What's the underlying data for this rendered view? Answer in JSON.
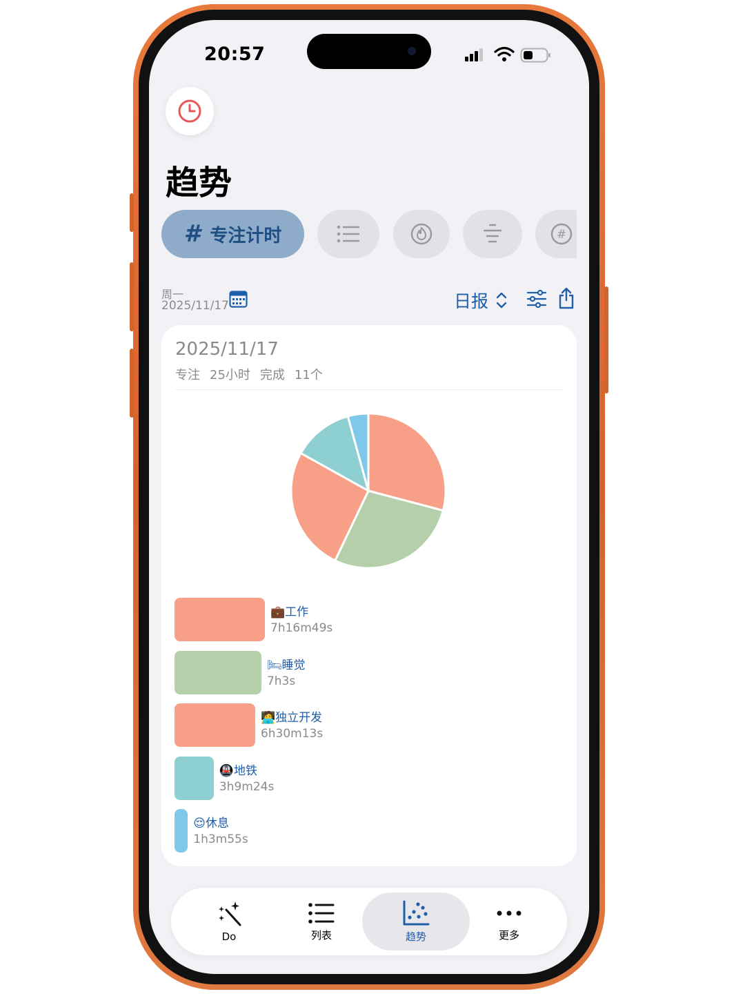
{
  "status_bar": {
    "time": "20:57"
  },
  "page": {
    "title": "趋势"
  },
  "filter_tabs": {
    "active_label": "专注计时",
    "active_icon": "#"
  },
  "date_header": {
    "weekday": "周一",
    "date": "2025/11/17",
    "report_label": "日报"
  },
  "card": {
    "date": "2025/11/17",
    "focus_label": "专注",
    "focus_value": "25小时",
    "done_label": "完成",
    "done_value": "11个"
  },
  "chart_data": {
    "type": "pie",
    "slices": [
      {
        "label": "工作",
        "emoji": "💼",
        "duration": "7h16m49s",
        "hours": 7.28,
        "color": "#f79f87"
      },
      {
        "label": "睡觉",
        "emoji": "🛏",
        "duration": "7h3s",
        "hours": 7.0,
        "color": "#b4cfa9"
      },
      {
        "label": "独立开发",
        "emoji": "🧑‍💻",
        "duration": "6h30m13s",
        "hours": 6.5,
        "color": "#f79f87"
      },
      {
        "label": "地铁",
        "emoji": "🚇",
        "duration": "3h9m24s",
        "hours": 3.16,
        "color": "#8ed0d2"
      },
      {
        "label": "休息",
        "emoji": "😌",
        "duration": "1h3m55s",
        "hours": 1.07,
        "color": "#7ec8e9"
      }
    ]
  },
  "bottom_nav": {
    "items": [
      {
        "label": "Do",
        "icon": "magic-wand-icon"
      },
      {
        "label": "列表",
        "icon": "list-icon"
      },
      {
        "label": "趋势",
        "icon": "chart-icon",
        "active": true
      },
      {
        "label": "更多",
        "icon": "more-icon"
      }
    ]
  }
}
